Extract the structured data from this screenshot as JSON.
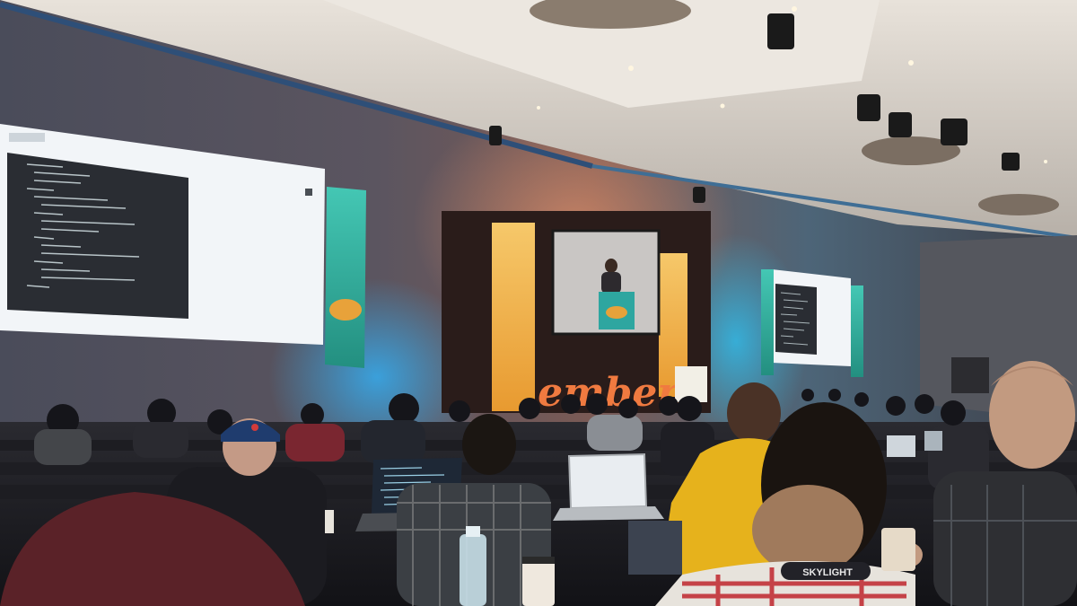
{
  "stage": {
    "logo_word": "ember."
  },
  "laptop_sticker": "SKYLIGHT",
  "colors": {
    "wall_blue": "#2f7fb8",
    "ceiling": "#d9d3cc",
    "banner_orange": "#f0a030",
    "banner_teal": "#2fb3a0",
    "logo_orange": "#f07a40",
    "screen_white": "#f4f6f8",
    "code_bg": "#2a2d33",
    "cap_navy": "#1f3c6e",
    "jacket_yellow": "#e6b21c"
  }
}
